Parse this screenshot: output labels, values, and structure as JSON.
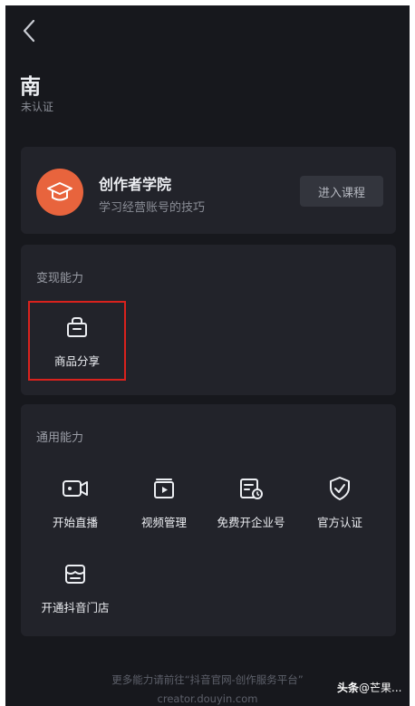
{
  "profile": {
    "name": "南",
    "status": "未认证"
  },
  "academy": {
    "title": "创作者学院",
    "subtitle": "学习经营账号的技巧",
    "button_label": "进入课程",
    "icon": "graduation-cap-icon",
    "icon_color": "#e8643d"
  },
  "monetize": {
    "title": "变现能力",
    "items": [
      {
        "label": "商品分享",
        "icon": "shopping-bag-icon"
      }
    ]
  },
  "general": {
    "title": "通用能力",
    "items": [
      {
        "label": "开始直播",
        "icon": "video-camera-icon"
      },
      {
        "label": "视频管理",
        "icon": "video-folder-icon"
      },
      {
        "label": "免费开企业号",
        "icon": "enterprise-doc-icon"
      },
      {
        "label": "官方认证",
        "icon": "verified-shield-icon"
      },
      {
        "label": "开通抖音门店",
        "icon": "store-icon"
      }
    ]
  },
  "footer": {
    "line1": "更多能力请前往“抖音官网-创作服务平台”",
    "line2": "creator.douyin.com"
  },
  "watermark": {
    "brand": "头条",
    "handle": "@芒果..."
  },
  "colors": {
    "background": "#17181d",
    "card": "#22232a",
    "accent": "#e8643d",
    "highlight": "#d9221d"
  }
}
